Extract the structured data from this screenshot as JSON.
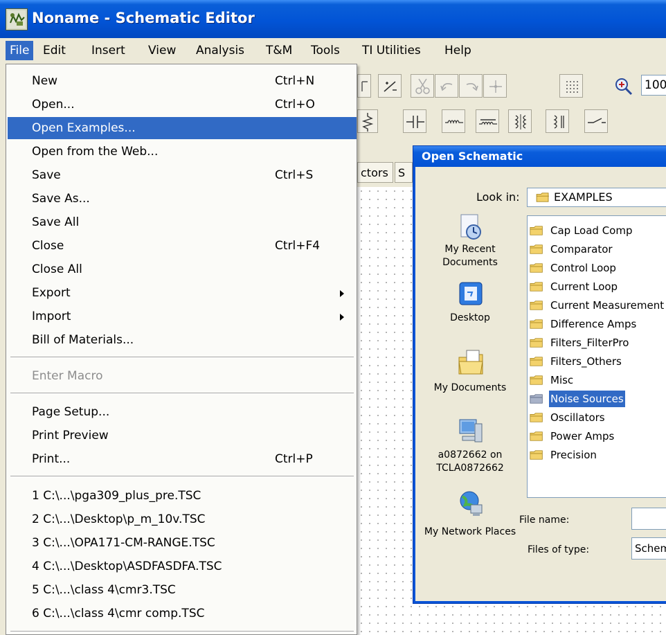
{
  "window": {
    "title": "Noname - Schematic Editor"
  },
  "menubar": [
    "File",
    "Edit",
    "Insert",
    "View",
    "Analysis",
    "T&M",
    "Tools",
    "TI Utilities",
    "Help"
  ],
  "toolbar": {
    "zoom_value": "100"
  },
  "component_tabs": [
    "ctors",
    "S"
  ],
  "file_menu": {
    "items": [
      {
        "label": "New",
        "shortcut": "Ctrl+N"
      },
      {
        "label": "Open...",
        "shortcut": "Ctrl+O"
      },
      {
        "label": "Open Examples...",
        "shortcut": ""
      },
      {
        "label": "Open from the Web...",
        "shortcut": ""
      },
      {
        "label": "Save",
        "shortcut": "Ctrl+S"
      },
      {
        "label": "Save As...",
        "shortcut": ""
      },
      {
        "label": "Save All",
        "shortcut": ""
      },
      {
        "label": "Close",
        "shortcut": "Ctrl+F4"
      },
      {
        "label": "Close All",
        "shortcut": ""
      },
      {
        "label": "Export",
        "shortcut": ""
      },
      {
        "label": "Import",
        "shortcut": ""
      },
      {
        "label": "Bill of Materials...",
        "shortcut": ""
      },
      {
        "label": "Enter Macro",
        "shortcut": ""
      },
      {
        "label": "Page Setup...",
        "shortcut": ""
      },
      {
        "label": "Print Preview",
        "shortcut": ""
      },
      {
        "label": "Print...",
        "shortcut": "Ctrl+P"
      },
      {
        "label": "1 C:\\...\\pga309_plus_pre.TSC",
        "shortcut": ""
      },
      {
        "label": "2 C:\\...\\Desktop\\p_m_10v.TSC",
        "shortcut": ""
      },
      {
        "label": "3 C:\\...\\OPA171-CM-RANGE.TSC",
        "shortcut": ""
      },
      {
        "label": "4 C:\\...\\Desktop\\ASDFASDFA.TSC",
        "shortcut": ""
      },
      {
        "label": "5 C:\\...\\class 4\\cmr3.TSC",
        "shortcut": ""
      },
      {
        "label": "6 C:\\...\\class 4\\cmr comp.TSC",
        "shortcut": ""
      }
    ]
  },
  "dialog": {
    "title": "Open Schematic",
    "look_in_label": "Look in:",
    "look_in_value": "EXAMPLES",
    "places": [
      {
        "label": "My Recent Documents"
      },
      {
        "label": "Desktop"
      },
      {
        "label": "My Documents"
      },
      {
        "label": "a0872662 on TCLA0872662"
      },
      {
        "label": "My Network Places"
      }
    ],
    "folders": [
      "Cap Load Comp",
      "Comparator",
      "Control Loop",
      "Current Loop",
      "Current Measurement",
      "Difference Amps",
      "Filters_FilterPro",
      "Filters_Others",
      "Misc",
      "Noise Sources",
      "Oscillators",
      "Power Amps",
      "Precision"
    ],
    "selected_folder": "Noise Sources",
    "file_name_label": "File name:",
    "file_name_value": "",
    "files_of_type_label": "Files of type:",
    "files_of_type_value": "Schem"
  }
}
